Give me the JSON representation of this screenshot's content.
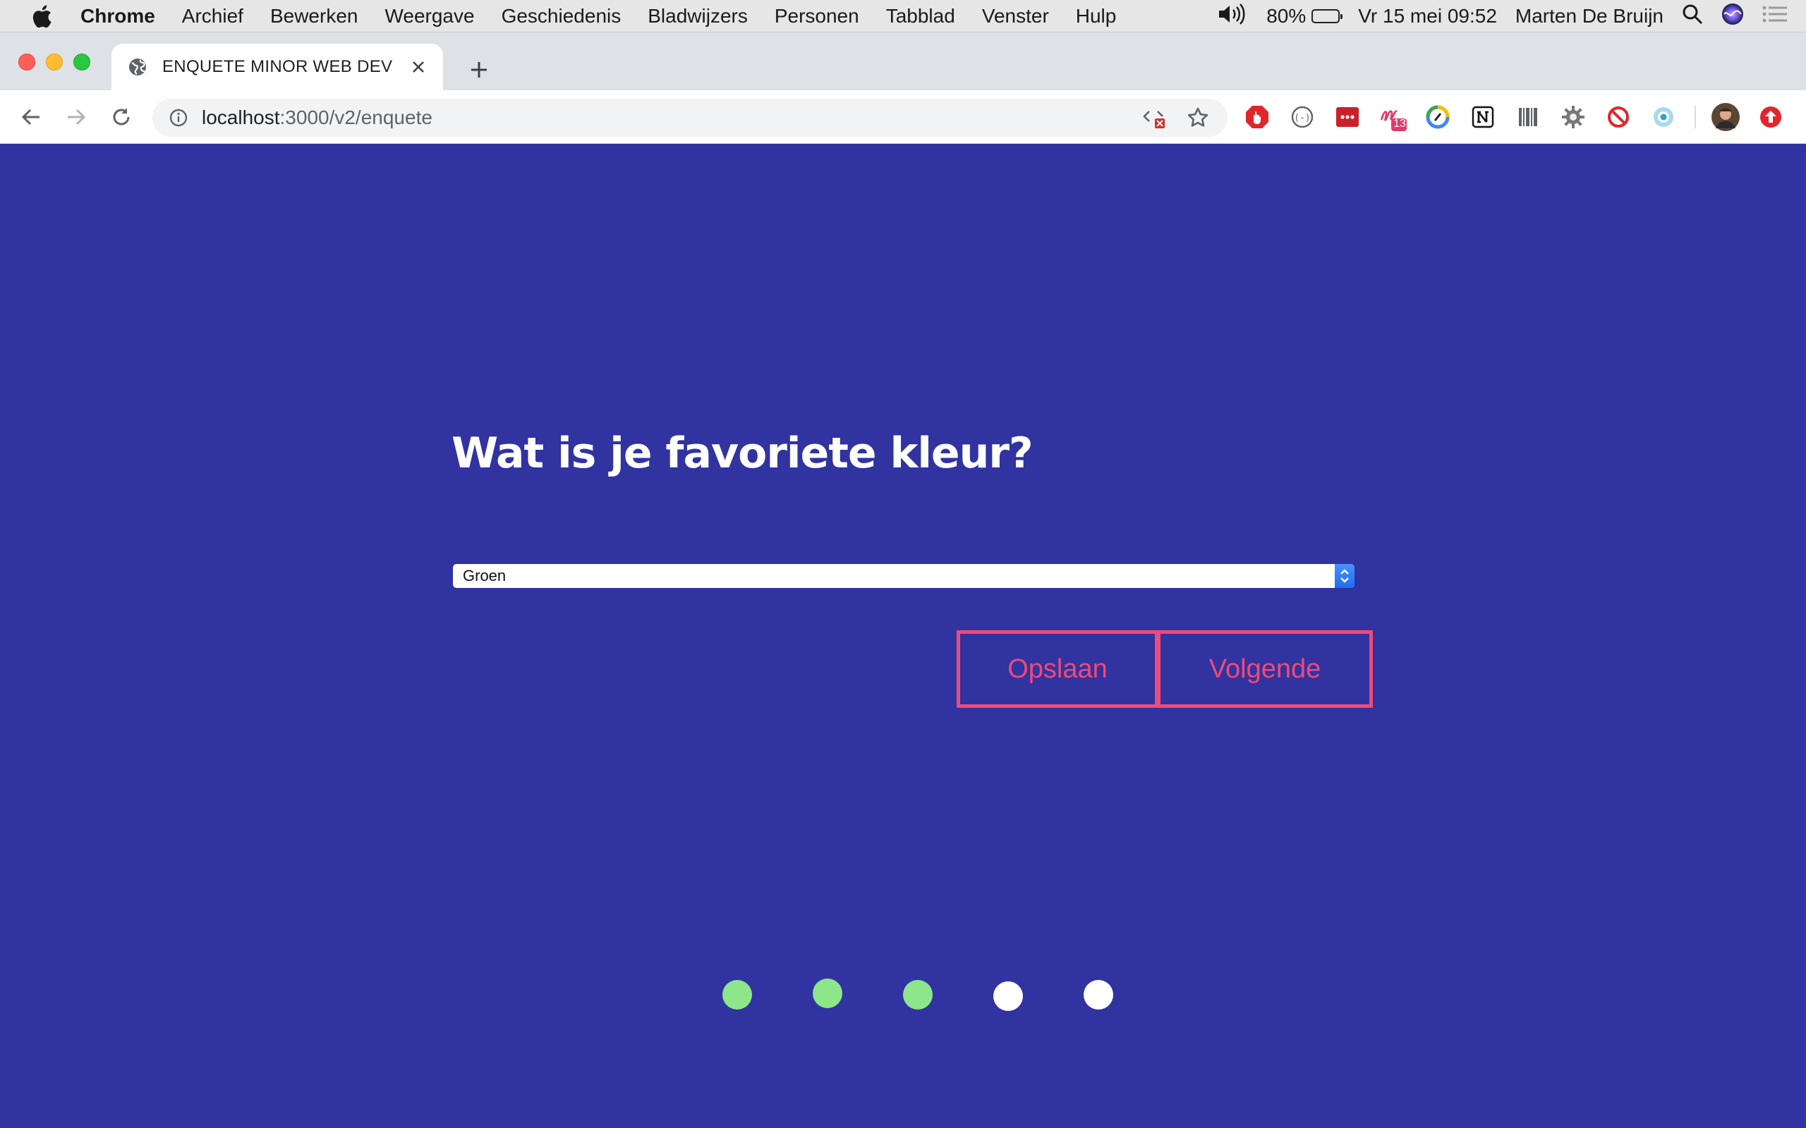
{
  "menubar": {
    "app": "Chrome",
    "items": [
      "Archief",
      "Bewerken",
      "Weergave",
      "Geschiedenis",
      "Bladwijzers",
      "Personen",
      "Tabblad",
      "Venster",
      "Hulp"
    ],
    "battery": "80%",
    "datetime": "Vr 15 mei  09:52",
    "user": "Marten De Bruijn"
  },
  "browser": {
    "tab_title": "ENQUETE MINOR WEB DEV",
    "url_host": "localhost",
    "url_path": ":3000/v2/enquete",
    "extension_badge": "13"
  },
  "survey": {
    "question": "Wat is je favoriete kleur?",
    "selected_option": "Groen",
    "save_label": "Opslaan",
    "next_label": "Volgende",
    "progress": {
      "completed": 3,
      "total": 5
    },
    "colors": {
      "background": "#3033a0",
      "accent": "#ef4a78",
      "done": "#8ee68a",
      "todo": "#ffffff"
    }
  }
}
